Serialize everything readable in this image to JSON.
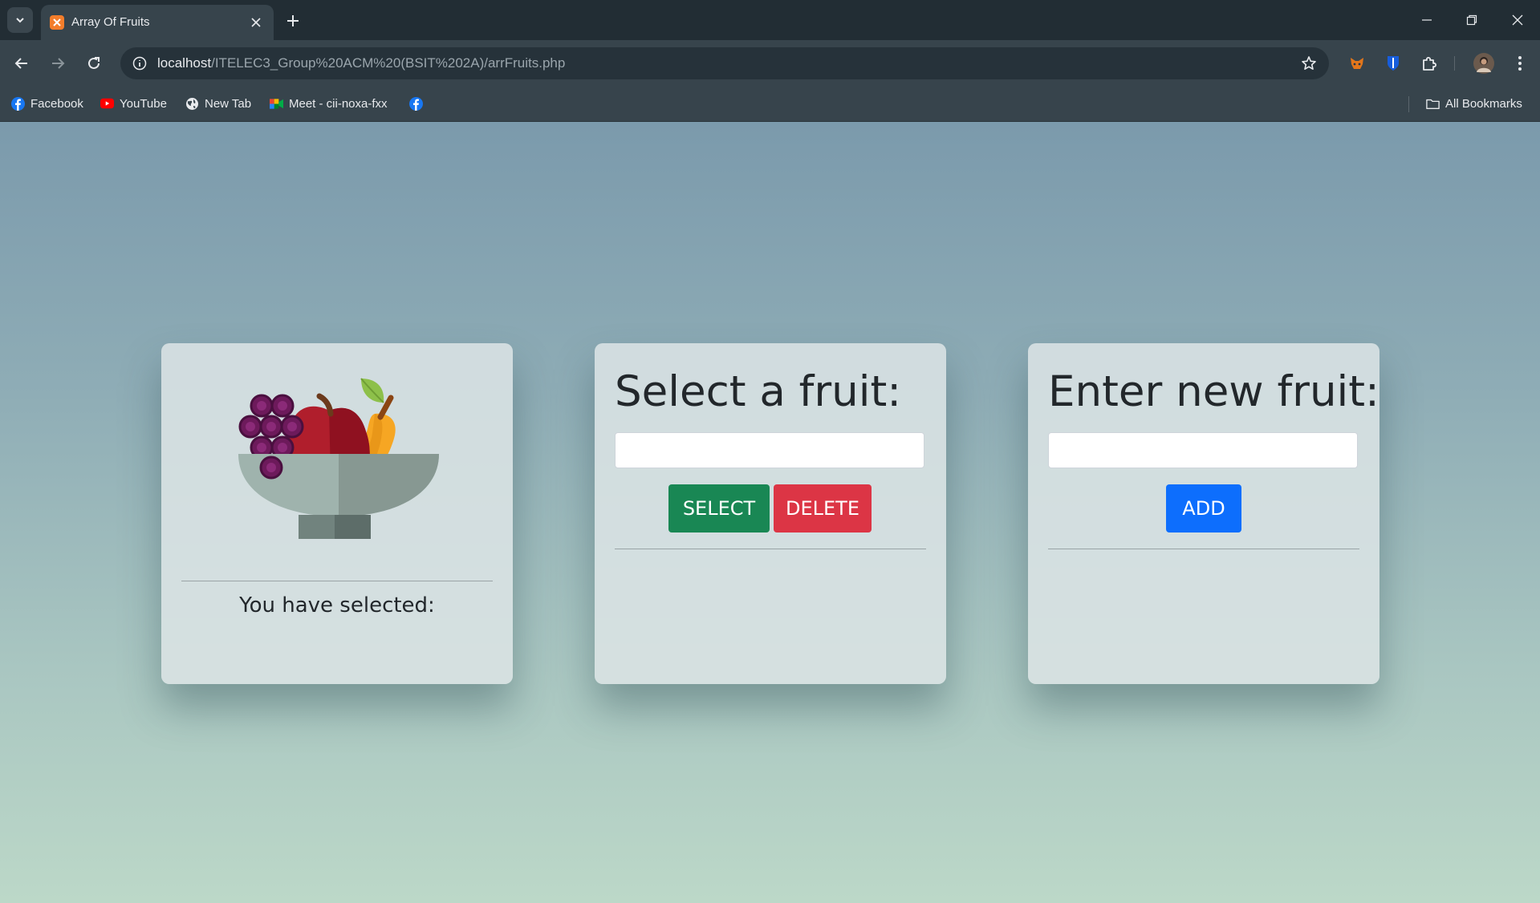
{
  "browser": {
    "tab_title": "Array Of Fruits",
    "url_host": "localhost",
    "url_path": "/ITELEC3_Group%20ACM%20(BSIT%202A)/arrFruits.php",
    "bookmarks": [
      {
        "label": "Facebook",
        "icon": "facebook-icon"
      },
      {
        "label": "YouTube",
        "icon": "youtube-icon"
      },
      {
        "label": "New Tab",
        "icon": "globe-icon"
      },
      {
        "label": "Meet - cii-noxa-fxx",
        "icon": "meet-icon"
      },
      {
        "label": "",
        "icon": "facebook-icon"
      }
    ],
    "all_bookmarks": "All Bookmarks"
  },
  "cards": {
    "image_card": {
      "selected_text": "You have selected:",
      "image": "fruit-bowl-illustration"
    },
    "select_card": {
      "heading": "Select a fruit:",
      "input_value": "",
      "select_label": "SELECT",
      "delete_label": "DELETE"
    },
    "add_card": {
      "heading": "Enter new fruit:",
      "input_value": "",
      "add_label": "ADD"
    }
  },
  "colors": {
    "select": "#198754",
    "delete": "#dc3545",
    "add": "#0d6efd"
  }
}
